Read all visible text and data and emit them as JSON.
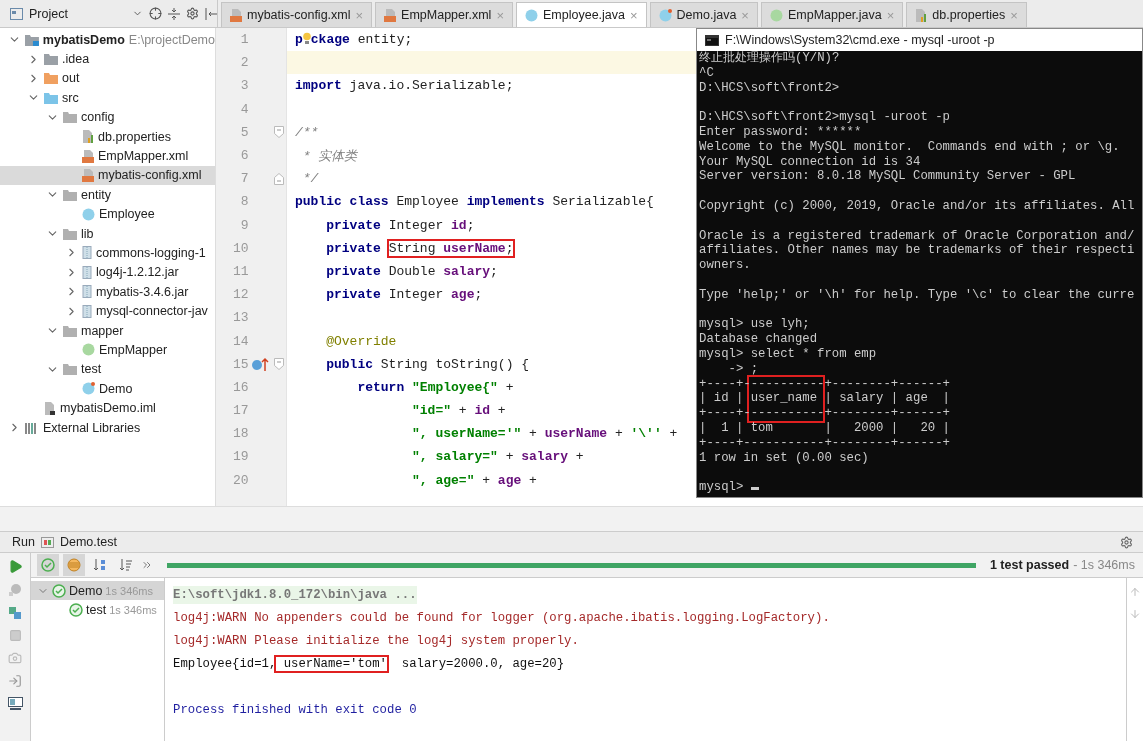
{
  "project_header": {
    "title": "Project"
  },
  "editor_tabs": [
    {
      "label": "mybatis-config.xml",
      "kind": "xml",
      "selected": false,
      "close": "×"
    },
    {
      "label": "EmpMapper.xml",
      "kind": "xml",
      "selected": false,
      "close": "×"
    },
    {
      "label": "Employee.java",
      "kind": "class",
      "selected": true,
      "close": "×"
    },
    {
      "label": "Demo.java",
      "kind": "test-class",
      "selected": false,
      "close": "×"
    },
    {
      "label": "EmpMapper.java",
      "kind": "interface",
      "selected": false,
      "close": "×"
    },
    {
      "label": "db.properties",
      "kind": "properties",
      "selected": false,
      "close": "×"
    }
  ],
  "project_tree": [
    {
      "label": "mybatisDemo",
      "path": "E:\\projectDemo",
      "kind": "module",
      "expanded": true,
      "selected": false,
      "children": [
        {
          "label": ".idea",
          "kind": "folder",
          "expanded": false,
          "selected": false
        },
        {
          "label": "out",
          "kind": "output-folder",
          "expanded": false,
          "selected": false
        },
        {
          "label": "src",
          "kind": "source-folder",
          "expanded": true,
          "selected": false,
          "children": [
            {
              "label": "config",
              "kind": "package",
              "expanded": true,
              "selected": false,
              "children": [
                {
                  "label": "db.properties",
                  "kind": "properties",
                  "selected": false
                },
                {
                  "label": "EmpMapper.xml",
                  "kind": "xml",
                  "selected": false
                },
                {
                  "label": "mybatis-config.xml",
                  "kind": "xml",
                  "selected": true
                }
              ]
            },
            {
              "label": "entity",
              "kind": "package",
              "expanded": true,
              "selected": false,
              "children": [
                {
                  "label": "Employee",
                  "kind": "class",
                  "selected": false
                }
              ]
            },
            {
              "label": "lib",
              "kind": "package",
              "expanded": true,
              "selected": false,
              "children": [
                {
                  "label": "commons-logging-1",
                  "kind": "jar",
                  "expanded": false,
                  "selected": false
                },
                {
                  "label": "log4j-1.2.12.jar",
                  "kind": "jar",
                  "expanded": false,
                  "selected": false
                },
                {
                  "label": "mybatis-3.4.6.jar",
                  "kind": "jar",
                  "expanded": false,
                  "selected": false
                },
                {
                  "label": "mysql-connector-jav",
                  "kind": "jar",
                  "expanded": false,
                  "selected": false
                }
              ]
            },
            {
              "label": "mapper",
              "kind": "package",
              "expanded": true,
              "selected": false,
              "children": [
                {
                  "label": "EmpMapper",
                  "kind": "interface",
                  "selected": false
                }
              ]
            },
            {
              "label": "test",
              "kind": "package",
              "expanded": true,
              "selected": false,
              "children": [
                {
                  "label": "Demo",
                  "kind": "test-class",
                  "selected": false
                }
              ]
            }
          ]
        },
        {
          "label": "mybatisDemo.iml",
          "kind": "iml",
          "selected": false
        }
      ]
    },
    {
      "label": "External Libraries",
      "kind": "libraries",
      "expanded": false,
      "selected": false
    }
  ],
  "editor": {
    "lines": [
      {
        "number": "1",
        "current": false,
        "tokens": [
          {
            "kind": "keyword",
            "text": "p"
          },
          {
            "kind": "bulb"
          },
          {
            "kind": "keyword",
            "text": "ckage"
          },
          {
            "kind": "plain",
            "text": " entity;"
          }
        ]
      },
      {
        "number": "2",
        "current": true
      },
      {
        "number": "3",
        "current": false,
        "tokens": [
          {
            "kind": "keyword",
            "text": "import"
          },
          {
            "kind": "plain",
            "text": " java.io.Serializable;"
          }
        ]
      },
      {
        "number": "4",
        "current": false
      },
      {
        "number": "5",
        "current": false,
        "fold": {
          "kind": "start"
        },
        "tokens": [
          {
            "kind": "comment",
            "text": "/**"
          }
        ]
      },
      {
        "number": "6",
        "current": false,
        "tokens": [
          {
            "kind": "comment",
            "text": " * 实体类"
          }
        ]
      },
      {
        "number": "7",
        "current": false,
        "fold": {
          "kind": "end"
        },
        "tokens": [
          {
            "kind": "comment",
            "text": " */"
          }
        ]
      },
      {
        "number": "8",
        "current": false,
        "tokens": [
          {
            "kind": "keyword",
            "text": "public class"
          },
          {
            "kind": "plain",
            "text": " Employee "
          },
          {
            "kind": "keyword",
            "text": "implements"
          },
          {
            "kind": "plain",
            "text": " Serializable{"
          }
        ]
      },
      {
        "number": "9",
        "current": false,
        "tokens": [
          {
            "kind": "keyword",
            "text": "    private"
          },
          {
            "kind": "plain",
            "text": " Integer "
          },
          {
            "kind": "field",
            "text": "id"
          },
          {
            "kind": "plain",
            "text": ";"
          }
        ]
      },
      {
        "number": "10",
        "current": false,
        "tokens": [
          {
            "kind": "keyword",
            "text": "    private "
          },
          {
            "kind": "box",
            "tokens": [
              {
                "kind": "plain",
                "text": "String "
              },
              {
                "kind": "field",
                "text": "userName"
              },
              {
                "kind": "plain",
                "text": ";"
              }
            ]
          }
        ]
      },
      {
        "number": "11",
        "current": false,
        "tokens": [
          {
            "kind": "keyword",
            "text": "    private"
          },
          {
            "kind": "plain",
            "text": " Double "
          },
          {
            "kind": "field",
            "text": "salary"
          },
          {
            "kind": "plain",
            "text": ";"
          }
        ]
      },
      {
        "number": "12",
        "current": false,
        "tokens": [
          {
            "kind": "keyword",
            "text": "    private"
          },
          {
            "kind": "plain",
            "text": " Integer "
          },
          {
            "kind": "field",
            "text": "age"
          },
          {
            "kind": "plain",
            "text": ";"
          }
        ]
      },
      {
        "number": "13",
        "current": false
      },
      {
        "number": "14",
        "current": false,
        "tokens": [
          {
            "kind": "annotation",
            "text": "    @Override"
          }
        ]
      },
      {
        "number": "15",
        "current": false,
        "fold": {
          "kind": "start"
        },
        "marker": {
          "kind": "override"
        },
        "tokens": [
          {
            "kind": "keyword",
            "text": "    public"
          },
          {
            "kind": "plain",
            "text": " String toString() {"
          }
        ]
      },
      {
        "number": "16",
        "current": false,
        "tokens": [
          {
            "kind": "keyword",
            "text": "        return "
          },
          {
            "kind": "string",
            "text": "\"Employee{\""
          },
          {
            "kind": "plain",
            "text": " +"
          }
        ]
      },
      {
        "number": "17",
        "current": false,
        "tokens": [
          {
            "kind": "string",
            "text": "               \"id=\""
          },
          {
            "kind": "plain",
            "text": " + "
          },
          {
            "kind": "field",
            "text": "id"
          },
          {
            "kind": "plain",
            "text": " +"
          }
        ]
      },
      {
        "number": "18",
        "current": false,
        "tokens": [
          {
            "kind": "string",
            "text": "               \", userName='\""
          },
          {
            "kind": "plain",
            "text": " + "
          },
          {
            "kind": "field",
            "text": "userName"
          },
          {
            "kind": "plain",
            "text": " + "
          },
          {
            "kind": "string",
            "text": "'\\''"
          },
          {
            "kind": "plain",
            "text": " +"
          }
        ]
      },
      {
        "number": "19",
        "current": false,
        "tokens": [
          {
            "kind": "string",
            "text": "               \", salary=\""
          },
          {
            "kind": "plain",
            "text": " + "
          },
          {
            "kind": "field",
            "text": "salary"
          },
          {
            "kind": "plain",
            "text": " +"
          }
        ]
      },
      {
        "number": "20",
        "current": false,
        "tokens": [
          {
            "kind": "string",
            "text": "               \", age=\""
          },
          {
            "kind": "plain",
            "text": " + "
          },
          {
            "kind": "field",
            "text": "age"
          },
          {
            "kind": "plain",
            "text": " +"
          }
        ]
      }
    ]
  },
  "terminal": {
    "title": "F:\\Windows\\System32\\cmd.exe - mysql  -uroot -p",
    "lines": [
      {
        "kind": "text",
        "text": "终止批处理操作吗(Y/N)?"
      },
      {
        "kind": "text",
        "text": "^C"
      },
      {
        "kind": "text",
        "text": "D:\\HCS\\soft\\front2>"
      },
      {
        "kind": "blank"
      },
      {
        "kind": "text",
        "text": "D:\\HCS\\soft\\front2>mysql -uroot -p"
      },
      {
        "kind": "text",
        "text": "Enter password: ******"
      },
      {
        "kind": "text",
        "text": "Welcome to the MySQL monitor.  Commands end with ; or \\g."
      },
      {
        "kind": "text",
        "text": "Your MySQL connection id is 34"
      },
      {
        "kind": "text",
        "text": "Server version: 8.0.18 MySQL Community Server - GPL"
      },
      {
        "kind": "blank"
      },
      {
        "kind": "text",
        "text": "Copyright (c) 2000, 2019, Oracle and/or its affiliates. All"
      },
      {
        "kind": "blank"
      },
      {
        "kind": "text",
        "text": "Oracle is a registered trademark of Oracle Corporation and/"
      },
      {
        "kind": "text",
        "text": "affiliates. Other names may be trademarks of their respecti"
      },
      {
        "kind": "text",
        "text": "owners."
      },
      {
        "kind": "blank"
      },
      {
        "kind": "text",
        "text": "Type 'help;' or '\\h' for help. Type '\\c' to clear the curre"
      },
      {
        "kind": "blank"
      },
      {
        "kind": "text",
        "text": "mysql> use lyh;"
      },
      {
        "kind": "text",
        "text": "Database changed"
      },
      {
        "kind": "text",
        "text": "mysql> select * from emp"
      },
      {
        "kind": "text",
        "text": "    -> ;"
      },
      {
        "kind": "text",
        "text": "+----+-----------+--------+------+"
      },
      {
        "kind": "text",
        "text": "| id | user_name | salary | age  |"
      },
      {
        "kind": "text",
        "text": "+----+-----------+--------+------+"
      },
      {
        "kind": "text",
        "text": "|  1 | tom       |   2000 |   20 |"
      },
      {
        "kind": "text",
        "text": "+----+-----------+--------+------+"
      },
      {
        "kind": "text",
        "text": "1 row in set (0.00 sec)"
      },
      {
        "kind": "blank"
      },
      {
        "kind": "prompt",
        "text": "mysql> "
      }
    ]
  },
  "run_panel": {
    "title": "Run",
    "config": "Demo.test",
    "toolbar": [
      {
        "kind": "passed-filter",
        "on": true
      },
      {
        "kind": "ignored-filter",
        "on": true
      },
      {
        "kind": "sort-alpha",
        "on": false
      },
      {
        "kind": "sort-duration",
        "on": false
      }
    ],
    "progress": {
      "level": 1
    },
    "status": "1 test passed",
    "duration": "- 1s 346ms",
    "tests": [
      {
        "label": "Demo",
        "time": "1s 346ms",
        "expanded": true,
        "selected": true,
        "children": [
          {
            "label": "test",
            "time": "1s 346ms",
            "selected": false
          }
        ]
      }
    ],
    "console": [
      {
        "kind": "command",
        "tokens": [
          {
            "kind": "plain",
            "text": "E:\\soft\\jdk1.8.0_172\\bin\\java ..."
          }
        ]
      },
      {
        "kind": "warning",
        "tokens": [
          {
            "kind": "plain",
            "text": "log4j:WARN No appenders could be found for logger (org.apache.ibatis.logging.LogFactory)."
          }
        ]
      },
      {
        "kind": "warning",
        "tokens": [
          {
            "kind": "plain",
            "text": "log4j:WARN Please initialize the log4j system properly."
          }
        ]
      },
      {
        "kind": "output",
        "tokens": [
          {
            "kind": "plain",
            "text": "Employee{id=1,"
          },
          {
            "kind": "box",
            "tokens": [
              {
                "kind": "plain",
                "text": " userName='tom'"
              }
            ]
          },
          {
            "kind": "plain",
            "text": "  salary=2000.0, age=20}"
          }
        ]
      },
      {
        "kind": "blank"
      },
      {
        "kind": "system",
        "tokens": [
          {
            "kind": "plain",
            "text": "Process finished with exit code 0"
          }
        ]
      }
    ]
  }
}
